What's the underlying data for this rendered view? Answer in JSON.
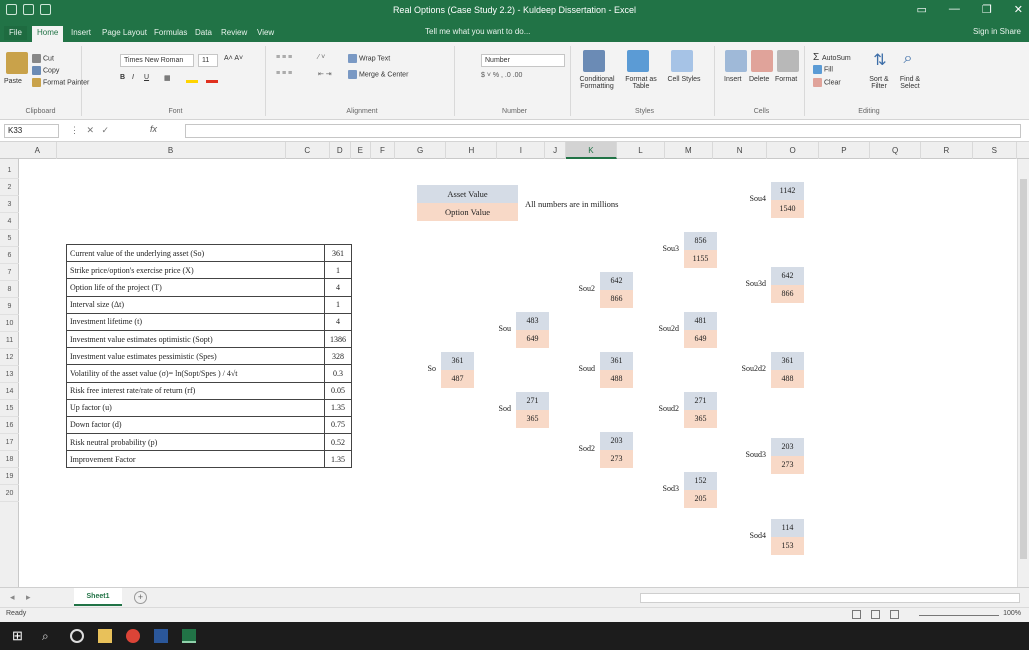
{
  "window": {
    "title": "Real Options (Case Study 2.2) - Kuldeep Dissertation - Excel",
    "controls": [
      "▭",
      "—",
      "❐",
      "✕"
    ]
  },
  "ribbon": {
    "tabs": [
      "File",
      "Home",
      "Insert",
      "Page Layout",
      "Formulas",
      "Data",
      "Review",
      "View"
    ],
    "active_tab": "Home",
    "tell_me": "Tell me what you want to do...",
    "sign_in": "Sign in  Share",
    "clipboard": {
      "cut": "Cut",
      "copy": "Copy",
      "format_painter": "Format Painter",
      "paste": "Paste",
      "label": "Clipboard"
    },
    "font": {
      "name": "Times New Roman",
      "size": "11",
      "label": "Font"
    },
    "alignment": {
      "wrap": "Wrap Text",
      "merge": "Merge & Center",
      "label": "Alignment"
    },
    "number": {
      "format": "Number",
      "label": "Number"
    },
    "styles": {
      "conditional": "Conditional Formatting",
      "format_table": "Format as Table",
      "cell_styles": "Cell Styles",
      "label": "Styles"
    },
    "cells": {
      "insert": "Insert",
      "delete": "Delete",
      "format": "Format",
      "label": "Cells"
    },
    "editing": {
      "autosum": "AutoSum",
      "fill": "Fill",
      "clear": "Clear",
      "sort": "Sort & Filter",
      "find": "Find & Select",
      "label": "Editing"
    }
  },
  "formula_bar": {
    "name_box": "K33",
    "fx": "fx",
    "value": ""
  },
  "columns": [
    "A",
    "B",
    "C",
    "D",
    "E",
    "F",
    "G",
    "H",
    "I",
    "J",
    "K",
    "L",
    "M",
    "N",
    "O",
    "P",
    "Q",
    "R",
    "S"
  ],
  "selected_column": "K",
  "rows": [
    "1",
    "2",
    "3",
    "4",
    "5",
    "6",
    "7",
    "8",
    "9",
    "10",
    "11",
    "12",
    "13",
    "14",
    "15",
    "16",
    "17",
    "18",
    "19",
    "20"
  ],
  "parameters": [
    {
      "label": "Current value of the underlying asset (So)",
      "value": "361"
    },
    {
      "label": "Strike price/option's exercise price (X)",
      "value": "1"
    },
    {
      "label": "Option life of the project (T)",
      "value": "4"
    },
    {
      "label": "Interval size (Δt)",
      "value": "1"
    },
    {
      "label": "Investment lifetime (t)",
      "value": "4"
    },
    {
      "label": "Investment value estimates optimistic (Sopt)",
      "value": "1386"
    },
    {
      "label": "Investment value estimates pessimistic (Spes)",
      "value": "328"
    },
    {
      "label": "Volatility of the asset value (σ)= ln(Sopt/Spes ) / 4√t",
      "value": "0.3"
    },
    {
      "label": "Risk free interest rate/rate of return (rf)",
      "value": "0.05"
    },
    {
      "label": "Up factor (u)",
      "value": "1.35"
    },
    {
      "label": "Down factor (d)",
      "value": "0.75"
    },
    {
      "label": "Risk neutral probability (p)",
      "value": "0.52"
    },
    {
      "label": "Improvement Factor",
      "value": "1.35"
    }
  ],
  "legend": {
    "asset": "Asset Value",
    "option": "Option Value",
    "note": "All numbers are in millions"
  },
  "legend_colors": {
    "asset": "#d5dce6",
    "option": "#f8d9c7"
  },
  "tree": [
    {
      "id": "So",
      "label": "So",
      "asset": "361",
      "option": "487"
    },
    {
      "id": "Sou",
      "label": "Sou",
      "asset": "483",
      "option": "649"
    },
    {
      "id": "Sod",
      "label": "Sod",
      "asset": "271",
      "option": "365"
    },
    {
      "id": "Sou2",
      "label": "Sou2",
      "asset": "642",
      "option": "866"
    },
    {
      "id": "Soud",
      "label": "Soud",
      "asset": "361",
      "option": "488"
    },
    {
      "id": "Sod2",
      "label": "Sod2",
      "asset": "203",
      "option": "273"
    },
    {
      "id": "Sou3",
      "label": "Sou3",
      "asset": "856",
      "option": "1155"
    },
    {
      "id": "Sou2d",
      "label": "Sou2d",
      "asset": "481",
      "option": "649"
    },
    {
      "id": "Soud2",
      "label": "Soud2",
      "asset": "271",
      "option": "365"
    },
    {
      "id": "Sod3",
      "label": "Sod3",
      "asset": "152",
      "option": "205"
    },
    {
      "id": "Sou4",
      "label": "Sou4",
      "asset": "1142",
      "option": "1540"
    },
    {
      "id": "Sou3d",
      "label": "Sou3d",
      "asset": "642",
      "option": "866"
    },
    {
      "id": "Sou2d2",
      "label": "Sou2d2",
      "asset": "361",
      "option": "488"
    },
    {
      "id": "Soud3",
      "label": "Soud3",
      "asset": "203",
      "option": "273"
    },
    {
      "id": "Sod4",
      "label": "Sod4",
      "asset": "114",
      "option": "153"
    }
  ],
  "sheet_tabs": {
    "active": "Sheet1",
    "add": "+"
  },
  "status": {
    "ready": "Ready",
    "zoom": "100%"
  },
  "brand": {
    "excel_green": "#217346"
  }
}
